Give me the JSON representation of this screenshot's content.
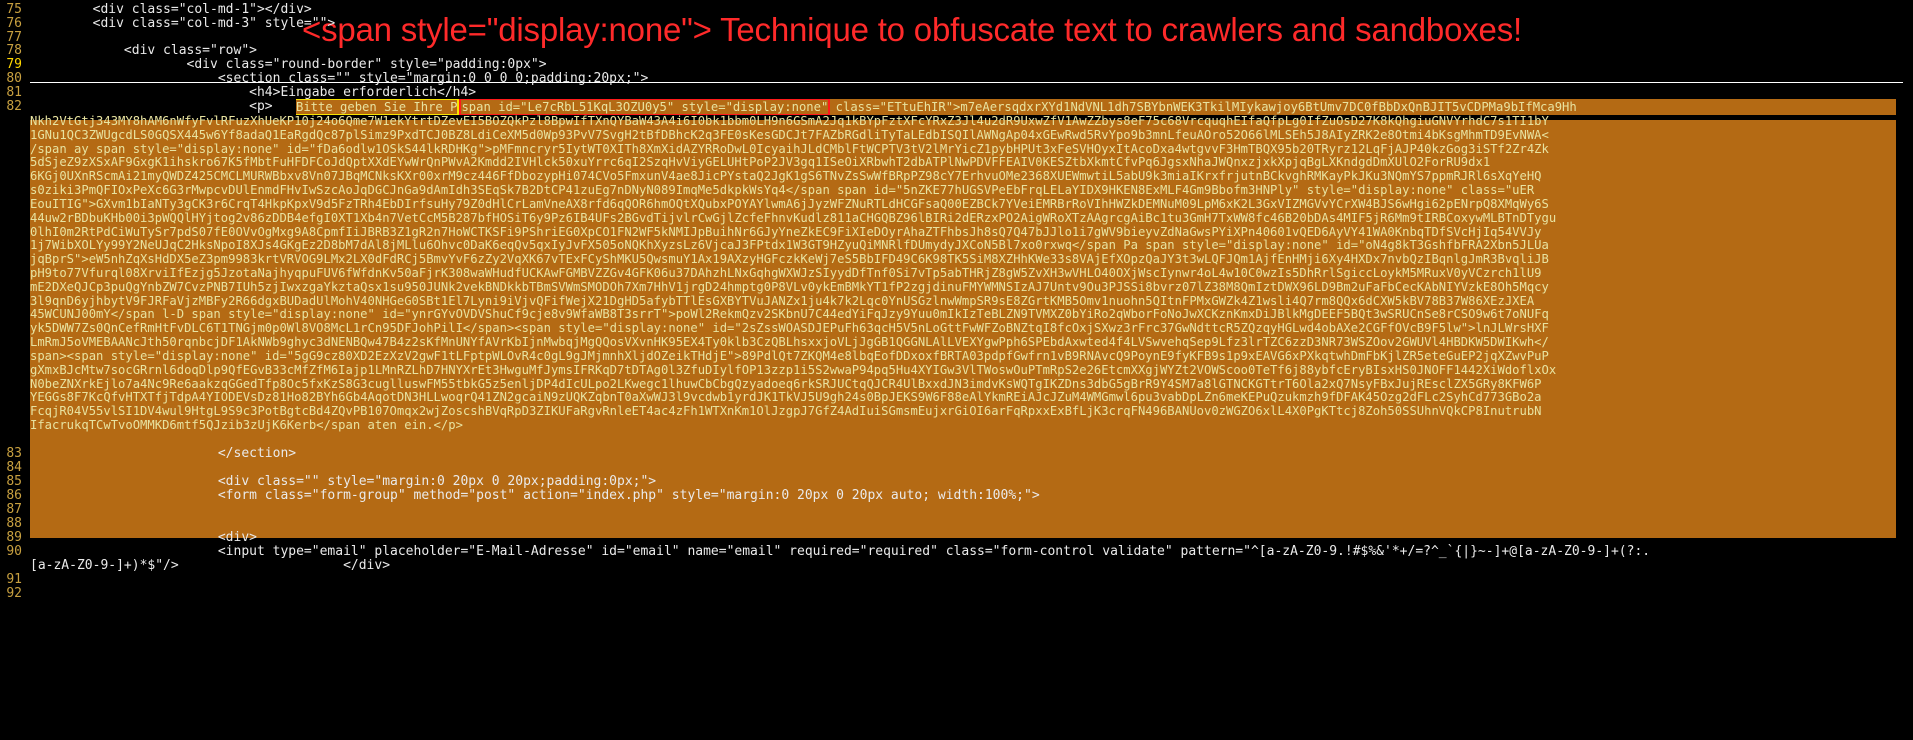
{
  "annotation": "<span style=\"display:none\"> Technique to obfuscate text to crawlers and sandboxes!",
  "lines": [
    {
      "n": "75",
      "text": "        <div class=\"col-md-1\"></div>"
    },
    {
      "n": "76",
      "text": "        <div class=\"col-md-3\" style=\"\">"
    },
    {
      "n": "77",
      "text": ""
    },
    {
      "n": "78",
      "text": "            <div class=\"row\">"
    },
    {
      "n": "79",
      "text": "                    <div class=\"round-border\" style=\"padding:0px\">"
    },
    {
      "n": "80",
      "text": "                        <section class=\"\" style=\"margin:0 0 0 0;padding:20px;\">"
    },
    {
      "n": "81",
      "text": "                            <h4>Eingabe erforderlich</h4>"
    },
    {
      "n": "82",
      "text": "                            <p>"
    },
    {
      "n": "83",
      "text": "                        </section>"
    },
    {
      "n": "84",
      "text": ""
    },
    {
      "n": "85",
      "text": "                        <div class=\"\" style=\"margin:0 20px 0 20px;padding:0px;\">"
    },
    {
      "n": "86",
      "text": "                        <form class=\"form-group\" method=\"post\" action=\"index.php\" style=\"margin:0 20px 0 20px auto; width:100%;\">"
    },
    {
      "n": "87",
      "text": ""
    },
    {
      "n": "88",
      "text": ""
    },
    {
      "n": "89",
      "text": "                        <div>"
    },
    {
      "n": "90",
      "text": "                        <input type=\"email\" placeholder=\"E-Mail-Adresse\" id=\"email\" name=\"email\" required=\"required\" class=\"form-control validate\" pattern=\"^[a-zA-Z0-9.!#$%&'*+/=?^_`{|}~-]+@[a-zA-Z0-9-]+(?:."
    },
    {
      "n": "",
      "text": "[a-zA-Z0-9-]+)*$\"/>                     </div>"
    },
    {
      "n": "91",
      "text": ""
    },
    {
      "n": "92",
      "text": ""
    }
  ],
  "line82": {
    "visible1": "Bitte geben Sie Ihre P",
    "hidden_span_open": "span id=\"Le7cRbL51KqL3OZU0y5\" style=\"display:none\"",
    "after": " class=\"ETtuEhIR\">m7eAersqdxrXYd1NdVNL1dh7SBYbnWEK3TkilMIykawjoy6BtUmv7DC0fBbDxQnBJIT5vCDPMa9bIfMca9Hh"
  },
  "wrap": [
    "Nkh2VtGtj343MY8hAM6nWfyFvlRFuzXhUeKP10j24o6Qme7W1ekYtrtDZevEI5BOZQkPzl8BpwIfTXnQYBaW43A4i6I0bk1bbm0LH9n6GSmA2Jq1kBYpFztXFcYRxZ3Jl4u2dR9UxwZfV1AwZZbys8eF75c68VrcquqhEIfaQfpLg0IfZuOsD27K8kQhgiuGNVYrhdC7s1TI1bY",
    "1GNu1QC3ZWUgcdLS0GQSX445w6Yf8adaQ1EaRgdQc87plSimz9PxdTCJ0BZ8LdiCeXM5d0Wp93PvV7SvgH2tBfDBhcK2q3FE0sKesGDCJt7FAZbRGdliTyTaLEdbISQIlAWNgAp04xGEwRwd5RvYpo9b3mnLfeuAOro52O66lMLSEh5J8AIyZRK2e8Otmi4bKsgMhmTD9EvNWA<",
    "/span ay span style=\"display:none\" id=\"fDa6odlw1OSkS44lkRDHKg\">pMFmncryr5IytWT0XITh8XmXidAZYRRoDwL0IcyaihJLdCMblFtWCPTV3tV2lMrYicZ1pybHPUt3xFeSVHOyxItAcoDxa4wtgvvF3HmTBQX95b20TRyrz12LqFjAJP40kzGog3iSTf2Zr4Zk",
    "5dSjeZ9zXSxAF9GxgK1ihskro67K5fMbtFuHFDFCoJdQptXXdEYwWrQnPWvA2Kmdd2IVHlck50xuYrrc6qI2SzqHvViyGELUHtPoP2JV3gq1ISeOiXRbwhT2dbATPlNwPDVFFEAIV0KESZtbXkmtCfvPq6JgsxNhaJWQnxzjxkXpjqBgLXKndgdDmXUlO2ForRU9dx1",
    "6KGj0UXnRScmAi21myQWDZ425CMCLMURWBbxv8Vn07JBqMCNksKXr00xrM9cz446FfDbozypHi074CVo5FmxunV4ae8JicPYstaQ2JgK1gS6TNvZsSwWfBRpPZ98cY7ErhvuOMe2368XUEWmwtiL5abU9k3miaIKrxfrjutnBCkvghRMKayPkJKu3NQmYS7ppmRJRl6sXqYeHQ",
    "s0ziki3PmQFIOxPeXc6G3rMwpcvDUlEnmdFHvIwSzcAoJqDGCJnGa9dAmIdh3SEqSk7B2DtCP41zuEg7nDNyN089ImqMe5dkpkWsYq4</span span id=\"5nZKE77hUGSVPeEbFrqLELaYIDX9HKEN8ExMLF4Gm9Bbofm3HNPly\" style=\"display:none\" class=\"uER",
    "EouITIG\">GXvm1bIaNTy3gCK3r6CrqT4HkpKpxV9d5FzTRh4EbDIrfsuHy79Z0dHlCrLamVneAX8rfd6qQOR6hmOQtXQubxPOYAYlwmA6jJyzWFZNuRTLdHCGFsaQ00EZBCk7YVeiEMRBrRoVIhHWZkDEMNuM09LpM6xK2L3GxVIZMGVvYCrXW4BJS6wHgi62pENrpQ8XMqWy6S",
    "44uw2rBDbuKHb00i3pWQQlHYjtog2v86zDDB4efgI0XT1Xb4n7VetCcM5B287bfHOSiT6y9Pz6IB4UFs2BGvdTijvlrCwGjlZcfeFhnvKudlz811aCHGQBZ96lBIRi2dERzxPO2AigWRoXTzAAgrcgAiBc1tu3GmH7TxWW8fc46B20bDAs4MIF5jR6Mm9tIRBCoxywMLBTnDTygu",
    "0lhI0m2RtPdCiWuTySr7pdS07fE0OVvOgMxg9A8CpmfIiJBRB3Z1gR2n7HoWCTKSFi9PShriEG0XpCO1FN2WF5kNMIJpBuihNr6GJyYneZkEC9FiXIeDOyrAhaZTFhbsJh8sQ7Q47bJJlo1i7gWV9bieyvZdNaGwsPYiXPn40601vQED6AyVY41WA0KnbqTDfSVcHjIq54VVJy",
    "1j7WibXOLYy99Y2NeUJqC2HksNpoI8XJs4GKgEz2D8bM7dAl8jMLlu6Ohvc0DaK6eqQv5qxIyJvFX505oNQKhXyzsLz6VjcaJ3FPtdx1W3GT9HZyuQiMNRlfDUmydyJXCoN5Bl7xo0rxwq</span Pa span style=\"display:none\" id=\"oN4g8kT3GshfbFRA2Xbn5JLUa",
    "jqBprS\">eW5nhZqXsHdDX5eZ3pm9983krtVRVOG9LMx2LX0dFdRCj5BmvYvF6zZy2VqXK67vTExFCyShMKU5QwsmuY1Ax19AXzyHGFczkKeWj7eS5BbIFD49C6K98TK5SiM8XZHhKWe33s8VAjEfXOpzQaJY3t3wLQFJQm1AjfEnHMji6Xy4HXDx7nvbQzIBqnlgJmR3BvqliJB",
    "pH9to77Vfurql08XrviIfEzjg5JzotaNajhyqpuFUV6fWfdnKv50aFjrK308waWHudfUCKAwFGMBVZZGv4GFK06u37DAhzhLNxGqhgWXWJzSIyydDfTnf0Si7vTp5abTHRjZ8gW5ZvXH3wVHLO40OXjWscIynwr4oL4w10C0wzIs5DhRrlSgiccLoykM5MRuxV0yVCzrch1lU9",
    "mE2DXeQJCp3puQgYnbZW7CvzPNB7IUh5zjIwxzgaYkztaQsx1su950JUNk2vekBNDkkbTBmSVWmSMODOh7Xm7HhV1jrgD24hmptg0P8VLv0ykEmBMkYT1fP2zgjdinuFMYWMNSIzAJ7Untv9Ou3PJSSi8bvrz07lZ38M8QmIztDWX96LD9Bm2uFaFbCecKAbNIYVzkE8Oh5Mqcy",
    "3l9qnD6yjhbytV9FJRFaVjzMBFy2R66dgxBUDadUlMohV40NHGeG0SBt1El7Lyni9iVjvQFifWejX21DgHD5afybTTlEsGXBYTVuJANZx1ju4k7k2Lqc0YnUSGzlnwWmpSR9sE8ZGrtKMB5Omv1nuohn5QItnFPMxGWZk4Z1wsli4Q7rm8QQx6dCXW5kBV78B37W86XEzJXEA",
    "45WCUNJ00mY</span l-D span style=\"display:none\" id=\"ynrGYvOVDVShuCf9cje8v9WfaWB8T3srrT\">poWl2RekmQzv2SKbnU7C44edYiFqJzy9Yuu0mIkIzTeBLZN9TVMXZ0bYiRo2qWborFoNoJwXCKznKmxDiJBlkMgDEEF5BQt3wSRUCnSe8rCSO9w6t7oNUFq",
    "yk5DWW7Zs0QnCefRmHtFvDLC6T1TNGjm0p0Wl8VO8McL1rCn95DFJohPilI</span><span style=\"display:none\" id=\"2sZssWOASDJEPuFh63qcH5V5nLoGttFwWFZoBNZtqI8fcOxjSXwz3rFrc37GwNdttcR5ZQzqyHGLwd4obAXe2CGFfOVcB9F5lw\">lnJLWrsHXF",
    "LmRmJ5oVMEBAANcJth50rqnbcjDF1AkNWb9ghyc3dNENBQw47B4z2sKfMnUNYfAVrKbIjnMwbqjMgQQosVXvnHK95EX4Ty0klb3CzQBLhsxxjoVLjJgGB1QGGNLAlLVEXYgwPph6SPEbdAxwted4f4LVSwvehqSep9Lfz3lrTZC6zzD3NR73WSZOov2GWUVl4HBDKW5DWIKwh</",
    "span><span style=\"display:none\" id=\"5gG9cz80XD2EzXzV2gwF1tLFptpWLOvR4c0gL9gJMjmnhXljdOZeikTHdjE\">89PdlQt7ZKQM4e8lbqEofDDxoxfBRTA03pdpfGwfrn1vB9RNAvcQ9PoynE9fyKFB9s1p9xEAVG6xPXkqtwhDmFbKjlZR5eteGuEP2jqXZwvPuP",
    "gXmxBJcMtw7socGRrnl6doqDlp9QfEGvB33cMfZfM6Iajp1LMnRZLhD7HNYXrEt3HwguMfJymsIFRKqD7tDTAg0l3ZfuDIylfOP13zzp1i5S2wwaP94pq5Hu4XYIGw3VlTWoswOuPTmRpS2e26EtcmXXgjWYZt2VOWScoo0TeTf6j88ybfcEryBIsxHS0JNOFF1442XiWdoflxOx",
    "N0beZNXrkEjlo7a4Nc9Re6aakzqGGedTfp8Oc5fxKzS8G3cuglluswFM55tbkG5z5enljDP4dIcULpo2LKwegc1lhuwCbCbgQzyadoeq6rkSRJUCtqQJCR4UlBxxdJN3imdvKsWQTgIKZDns3dbG5gBrR9Y4SM7a8lGTNCKGTtrT6Ola2xQ7NsyFBxJujREsclZX5GRy8KFW6P",
    "YEGGs8F7KcQfvHTXTfjTdpA4YIODEVsDz81Ho82BYh6Gb4AqotDN3HLLwoqrQ41ZN2gcaiN9zUQKZqbnT0aXwWJ3l9vcdwb1yrdJK1TkVJ5U9gh24s0BpJEKS9W6F88eAlYkmREiAJcJZuM4WMGmwl6pu3vabDpLZn6meKEPuQzukmzh9fDFAK45Ozg2dFLc2SyhCd773GBo2a",
    "FcqjR04V55vlSI1DV4wul9HtgL9S9c3PotBgtcBd4ZQvPB107Omqx2wjZoscshBVqRpD3ZIKUFaRgvRnleET4ac4zFh1WTXnKm1OlJzgpJ7GfZ4AdIuiSGmsmEujxrGiOI6arFqRpxxExBfLjK3crqFN496BANUov0zWGZO6xlL4X0PgKTtcj8Zoh50SSUhnVQkCP8InutrubN",
    "IfacrukqTCwTvoOMMKD6mtf5QJzib3zUjK6Kerb</span aten ein.</p>"
  ],
  "colors": {
    "background": "#000000",
    "selection": "#b46a14",
    "annotation": "#ff2a2a",
    "red_box": "#ff1a1a",
    "yellow_box": "#f7e400",
    "line_number": "#c8a040"
  }
}
